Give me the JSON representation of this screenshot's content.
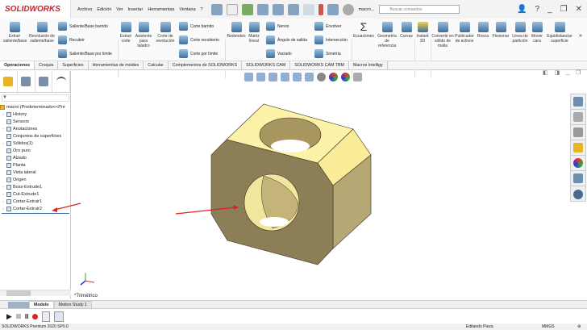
{
  "app": {
    "logo": "SOLIDWORKS",
    "file_label": "macro...",
    "search_placeholder": "Buscar comandos"
  },
  "menu": [
    "Archivo",
    "Edición",
    "Ver",
    "Insertar",
    "Herramientas",
    "Ventana",
    "?"
  ],
  "ribbon": {
    "big": [
      {
        "label": "Extruir saliente/base"
      },
      {
        "label": "Revolución de saliente/base"
      },
      {
        "label": "Extruir corte"
      },
      {
        "label": "Asistente para taladro"
      },
      {
        "label": "Corte de revolución"
      },
      {
        "label": "Redondeo"
      },
      {
        "label": "Matriz lineal"
      },
      {
        "label": "Ecuaciones"
      },
      {
        "label": "Geometría de referencia"
      },
      {
        "label": "Curvas"
      },
      {
        "label": "Instant 3D"
      },
      {
        "label": "Convertir en sólido de malla"
      },
      {
        "label": "Publicador de activos"
      },
      {
        "label": "Rosca"
      },
      {
        "label": "Flexionar"
      },
      {
        "label": "Línea de partición"
      },
      {
        "label": "Mover cara"
      },
      {
        "label": "Equidistanciar superficie"
      }
    ],
    "small": [
      "Saliente/Base barrido",
      "Recubrir",
      "Saliente/Base por límite",
      "Corte barrido",
      "Corte recubierto",
      "Corte por límite",
      "Nervio",
      "Ángulo de salida",
      "Vaciado",
      "Envolver",
      "Intersección",
      "Simetría"
    ]
  },
  "tabs": [
    "Operaciones",
    "Croquis",
    "Superficies",
    "Herramientas de moldes",
    "Calcular",
    "Complementos de SOLIDWORKS",
    "SOLIDWORKS CAM",
    "SOLIDWORKS CAM TBM",
    "Macros Intelligy"
  ],
  "tree": {
    "root": "macro  (Predeterminado<<Pre",
    "items": [
      {
        "label": "History",
        "arrow": true
      },
      {
        "label": "Sensors",
        "arrow": false
      },
      {
        "label": "Anotaciones",
        "arrow": true
      },
      {
        "label": "Conjuntos de superficies",
        "arrow": false
      },
      {
        "label": "Sólidos(1)",
        "arrow": true
      },
      {
        "label": "Oro puro",
        "arrow": false
      },
      {
        "label": "Alzado",
        "arrow": false
      },
      {
        "label": "Planta",
        "arrow": false
      },
      {
        "label": "Vista lateral",
        "arrow": false
      },
      {
        "label": "Origen",
        "arrow": false
      },
      {
        "label": "Boss-Extrude1",
        "arrow": true
      },
      {
        "label": "Cut-Extrude1",
        "arrow": true
      },
      {
        "label": "Cortar-Extruir1",
        "arrow": true
      },
      {
        "label": "Cortar-Extruir2",
        "arrow": true
      }
    ]
  },
  "viewport": {
    "view_label": "*Trimétrico"
  },
  "bottom_tabs": [
    "Modelo",
    "Motion Study 1"
  ],
  "status": {
    "version": "SOLIDWORKS Premium 2020 SP0.0",
    "mode": "Editando Pieza",
    "units": "MMGS"
  },
  "colors": {
    "accent": "#d0202e",
    "part_top": "#fdf3a8",
    "part_front": "#8c7e57",
    "part_right": "#b6a874",
    "arrow": "#e02020"
  }
}
